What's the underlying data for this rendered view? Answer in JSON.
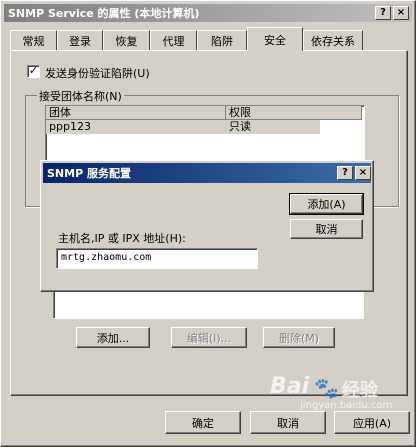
{
  "main_window": {
    "title": "SNMP Service 的属性 (本地计算机)",
    "help_glyph": "?",
    "close_glyph": "×",
    "tabs": [
      {
        "label": "常规"
      },
      {
        "label": "登录"
      },
      {
        "label": "恢复"
      },
      {
        "label": "代理"
      },
      {
        "label": "陷阱"
      },
      {
        "label": "安全"
      },
      {
        "label": "依存关系"
      }
    ],
    "active_tab": "安全",
    "send_auth_trap": {
      "label": "发送身份验证陷阱(U)",
      "checked": true,
      "mark": "✓"
    },
    "accepted_communities": {
      "group_label": "接受团体名称(N)",
      "columns": [
        "团体",
        "权限"
      ],
      "rows": [
        {
          "community": "ppp123",
          "rights": "只读"
        }
      ]
    },
    "hosts_buttons": {
      "add": "添加...",
      "edit": "编辑(I)...",
      "remove": "删除(M)"
    },
    "footer": {
      "ok": "确定",
      "cancel": "取消",
      "apply": "应用(A)"
    }
  },
  "dialog": {
    "title": "SNMP 服务配置",
    "help_glyph": "?",
    "close_glyph": "×",
    "add_button": "添加(A)",
    "cancel_button": "取消",
    "field_label": "主机名,IP 或 IPX 地址(H):",
    "field_value": "mrtg.zhaomu.com"
  },
  "watermark": {
    "brand": "Bai",
    "brand_cn": "经验",
    "url": "jingyan.baidu.com"
  }
}
